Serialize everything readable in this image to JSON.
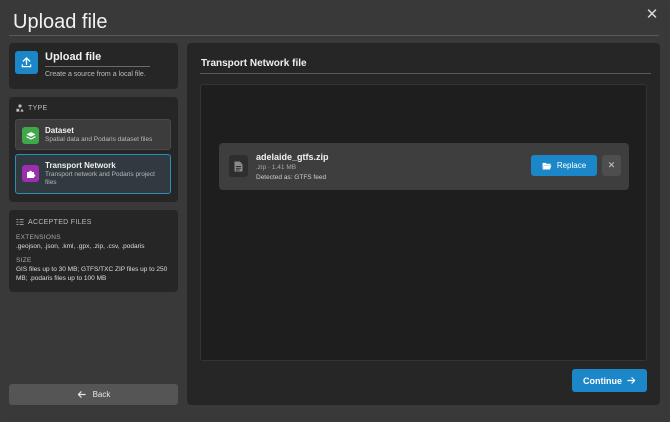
{
  "dialog": {
    "title": "Upload file",
    "close_glyph": "✕"
  },
  "sidebar": {
    "source": {
      "title": "Upload file",
      "subtitle": "Create a source from a local file.",
      "icon": "upload-icon"
    },
    "type": {
      "heading": "TYPE",
      "items": [
        {
          "title": "Dataset",
          "subtitle": "Spatial data and Podaris dataset files",
          "icon": "layers-icon",
          "color": "#3ea84a",
          "selected": false
        },
        {
          "title": "Transport Network",
          "subtitle": "Transport network and Podaris project files",
          "icon": "puzzle-icon",
          "color": "#9c2fae",
          "selected": true
        }
      ]
    },
    "accepted": {
      "heading": "ACCEPTED FILES",
      "extensions_label": "EXTENSIONS",
      "extensions": ".geojson, .json, .kml, .gpx, .zip, .csv, .podaris",
      "size_label": "SIZE",
      "size": "GIS files up to 30 MB; GTFS/TXC ZIP files up to 250 MB; .podaris files up to 100 MB"
    },
    "back_label": "Back"
  },
  "main": {
    "title": "Transport Network file",
    "file": {
      "name": "adelaide_gtfs.zip",
      "meta": ".zip · 1.41 MB",
      "detected": "Detected as: GTFS feed",
      "replace_label": "Replace",
      "remove_glyph": "✕"
    },
    "continue_label": "Continue"
  },
  "colors": {
    "accent": "#1b87c9",
    "panel": "#262626",
    "background": "#393939"
  }
}
